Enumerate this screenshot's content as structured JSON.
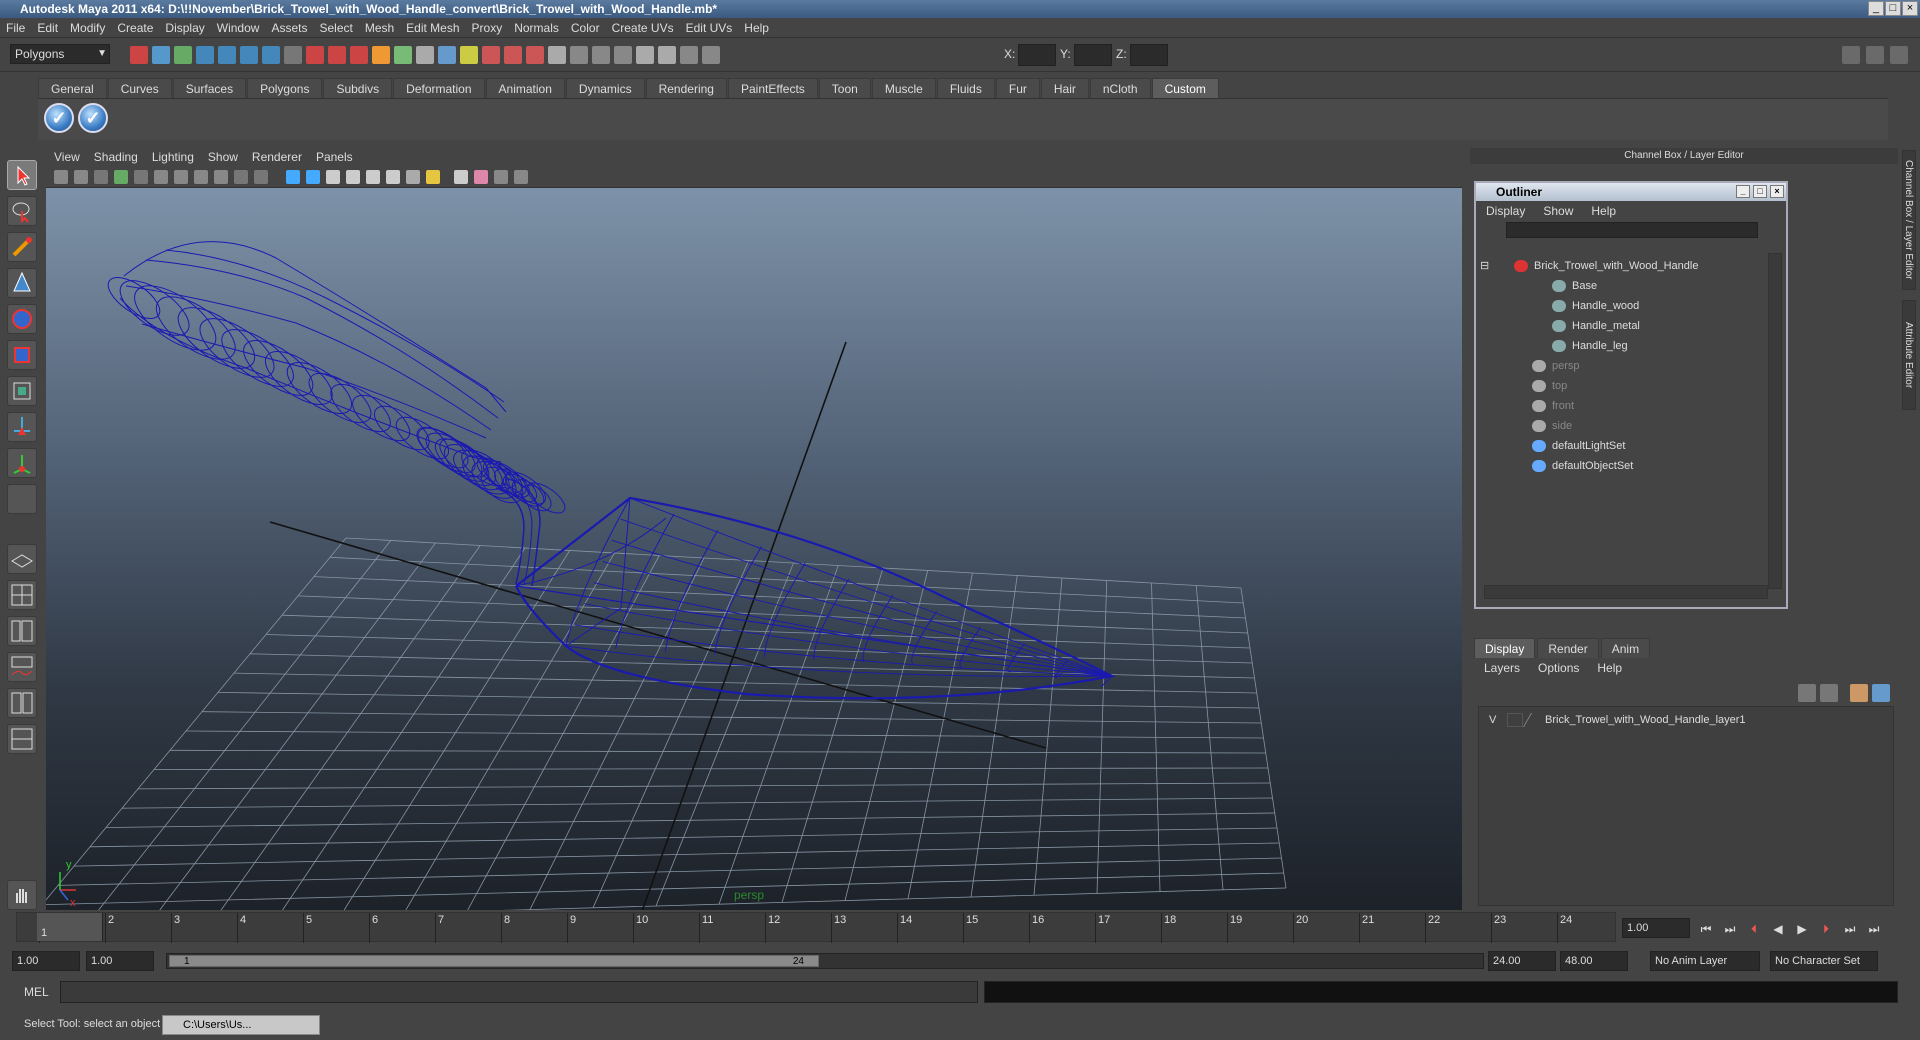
{
  "window": {
    "title": "Autodesk Maya 2011 x64: D:\\!!November\\Brick_Trowel_with_Wood_Handle_convert\\Brick_Trowel_with_Wood_Handle.mb*"
  },
  "menubar": [
    "File",
    "Edit",
    "Modify",
    "Create",
    "Display",
    "Window",
    "Assets",
    "Select",
    "Mesh",
    "Edit Mesh",
    "Proxy",
    "Normals",
    "Color",
    "Create UVs",
    "Edit UVs",
    "Help"
  ],
  "statusline": {
    "mode": "Polygons",
    "x_label": "X:",
    "y_label": "Y:",
    "z_label": "Z:"
  },
  "shelf": {
    "tabs": [
      "General",
      "Curves",
      "Surfaces",
      "Polygons",
      "Subdivs",
      "Deformation",
      "Animation",
      "Dynamics",
      "Rendering",
      "PaintEffects",
      "Toon",
      "Muscle",
      "Fluids",
      "Fur",
      "Hair",
      "nCloth",
      "Custom"
    ],
    "active_tab": "Custom",
    "icons": [
      "checkmark-icon",
      "checkmark-icon"
    ]
  },
  "viewport": {
    "menu": [
      "View",
      "Shading",
      "Lighting",
      "Show",
      "Renderer",
      "Panels"
    ],
    "camera": "persp",
    "wire_color": "#1a1ab0",
    "axis_x": "x",
    "axis_y": "y"
  },
  "right_panel": {
    "title": "Channel Box / Layer Editor",
    "side_tabs": [
      "Channel Box / Layer Editor",
      "Attribute Editor"
    ]
  },
  "outliner": {
    "title": "Outliner",
    "menu": [
      "Display",
      "Show",
      "Help"
    ],
    "items": [
      {
        "label": "Brick_Trowel_with_Wood_Handle",
        "depth": 0,
        "dim": false
      },
      {
        "label": "Base",
        "depth": 1,
        "dim": false
      },
      {
        "label": "Handle_wood",
        "depth": 1,
        "dim": false
      },
      {
        "label": "Handle_metal",
        "depth": 1,
        "dim": false
      },
      {
        "label": "Handle_leg",
        "depth": 1,
        "dim": false
      },
      {
        "label": "persp",
        "depth": 0,
        "dim": true
      },
      {
        "label": "top",
        "depth": 0,
        "dim": true
      },
      {
        "label": "front",
        "depth": 0,
        "dim": true
      },
      {
        "label": "side",
        "depth": 0,
        "dim": true
      },
      {
        "label": "defaultLightSet",
        "depth": 0,
        "dim": false
      },
      {
        "label": "defaultObjectSet",
        "depth": 0,
        "dim": false
      }
    ]
  },
  "layer_editor": {
    "tabs": [
      "Display",
      "Render",
      "Anim"
    ],
    "active_tab": "Display",
    "menu": [
      "Layers",
      "Options",
      "Help"
    ],
    "layers": [
      {
        "visible": "V",
        "name": "Brick_Trowel_with_Wood_Handle_layer1"
      }
    ]
  },
  "timeline": {
    "ticks": [
      "1",
      "2",
      "3",
      "4",
      "5",
      "6",
      "7",
      "8",
      "9",
      "10",
      "11",
      "12",
      "13",
      "14",
      "15",
      "16",
      "17",
      "18",
      "19",
      "20",
      "21",
      "22",
      "23",
      "24"
    ],
    "current_frame": "1",
    "current_time": "1.00"
  },
  "range": {
    "start": "1.00",
    "playback_start": "1.00",
    "handle_start": "1",
    "handle_end": "24",
    "playback_end": "24.00",
    "end": "48.00",
    "anim_layer": "No Anim Layer",
    "character_set": "No Character Set"
  },
  "command_line": {
    "label": "MEL"
  },
  "help_line": {
    "text": "Select Tool: select an object",
    "task": "C:\\Users\\Us..."
  }
}
